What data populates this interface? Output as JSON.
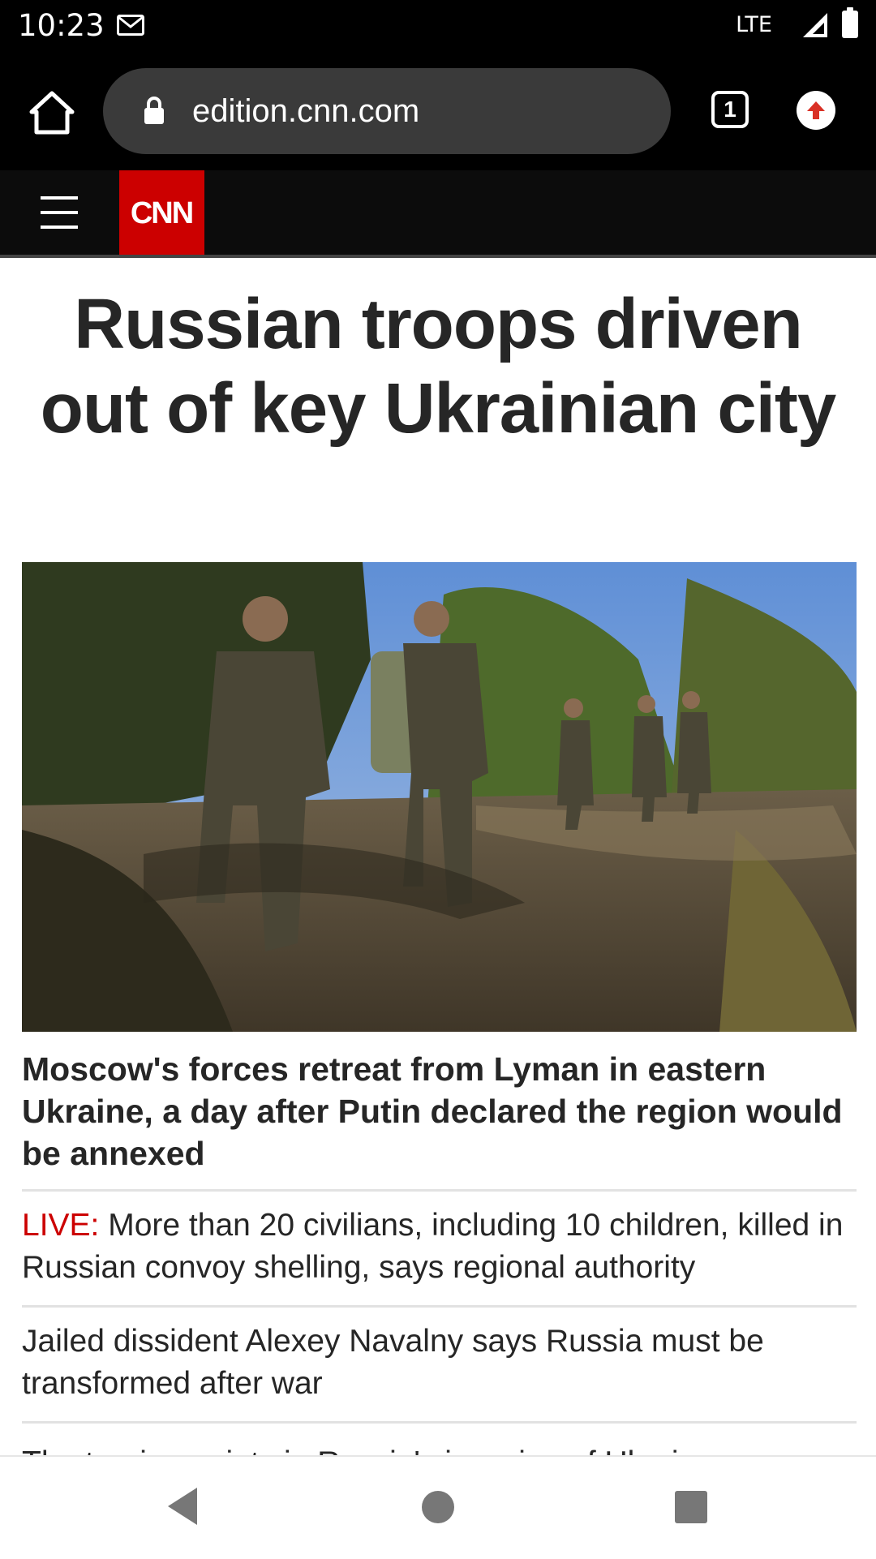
{
  "status": {
    "time": "10:23",
    "network": "LTE",
    "icons": [
      "gmail-icon",
      "signal-icon",
      "battery-icon"
    ]
  },
  "browser": {
    "url": "edition.cnn.com",
    "tab_count": "1",
    "icons": [
      "home-icon",
      "lock-icon",
      "tabs-icon",
      "update-icon"
    ]
  },
  "header": {
    "logo": "CNN",
    "brand_color": "#cc0000"
  },
  "article": {
    "headline": "Russian troops driven out of key Ukrainian city",
    "subhead": "Moscow's forces retreat from Lyman in eastern Ukraine, a day after Putin declared the region would be annexed",
    "stories": [
      {
        "tag": "LIVE:",
        "text": "More than 20 civilians, including 10 children, killed in Russian convoy shelling, says regional authority"
      },
      {
        "text": "Jailed dissident Alexey Navalny says Russia must be transformed after war"
      },
      {
        "text": "The turning points in Russia's invasion of Ukraine"
      }
    ]
  },
  "nav": {
    "icons": [
      "back-icon",
      "home-circle-icon",
      "recents-icon"
    ]
  }
}
